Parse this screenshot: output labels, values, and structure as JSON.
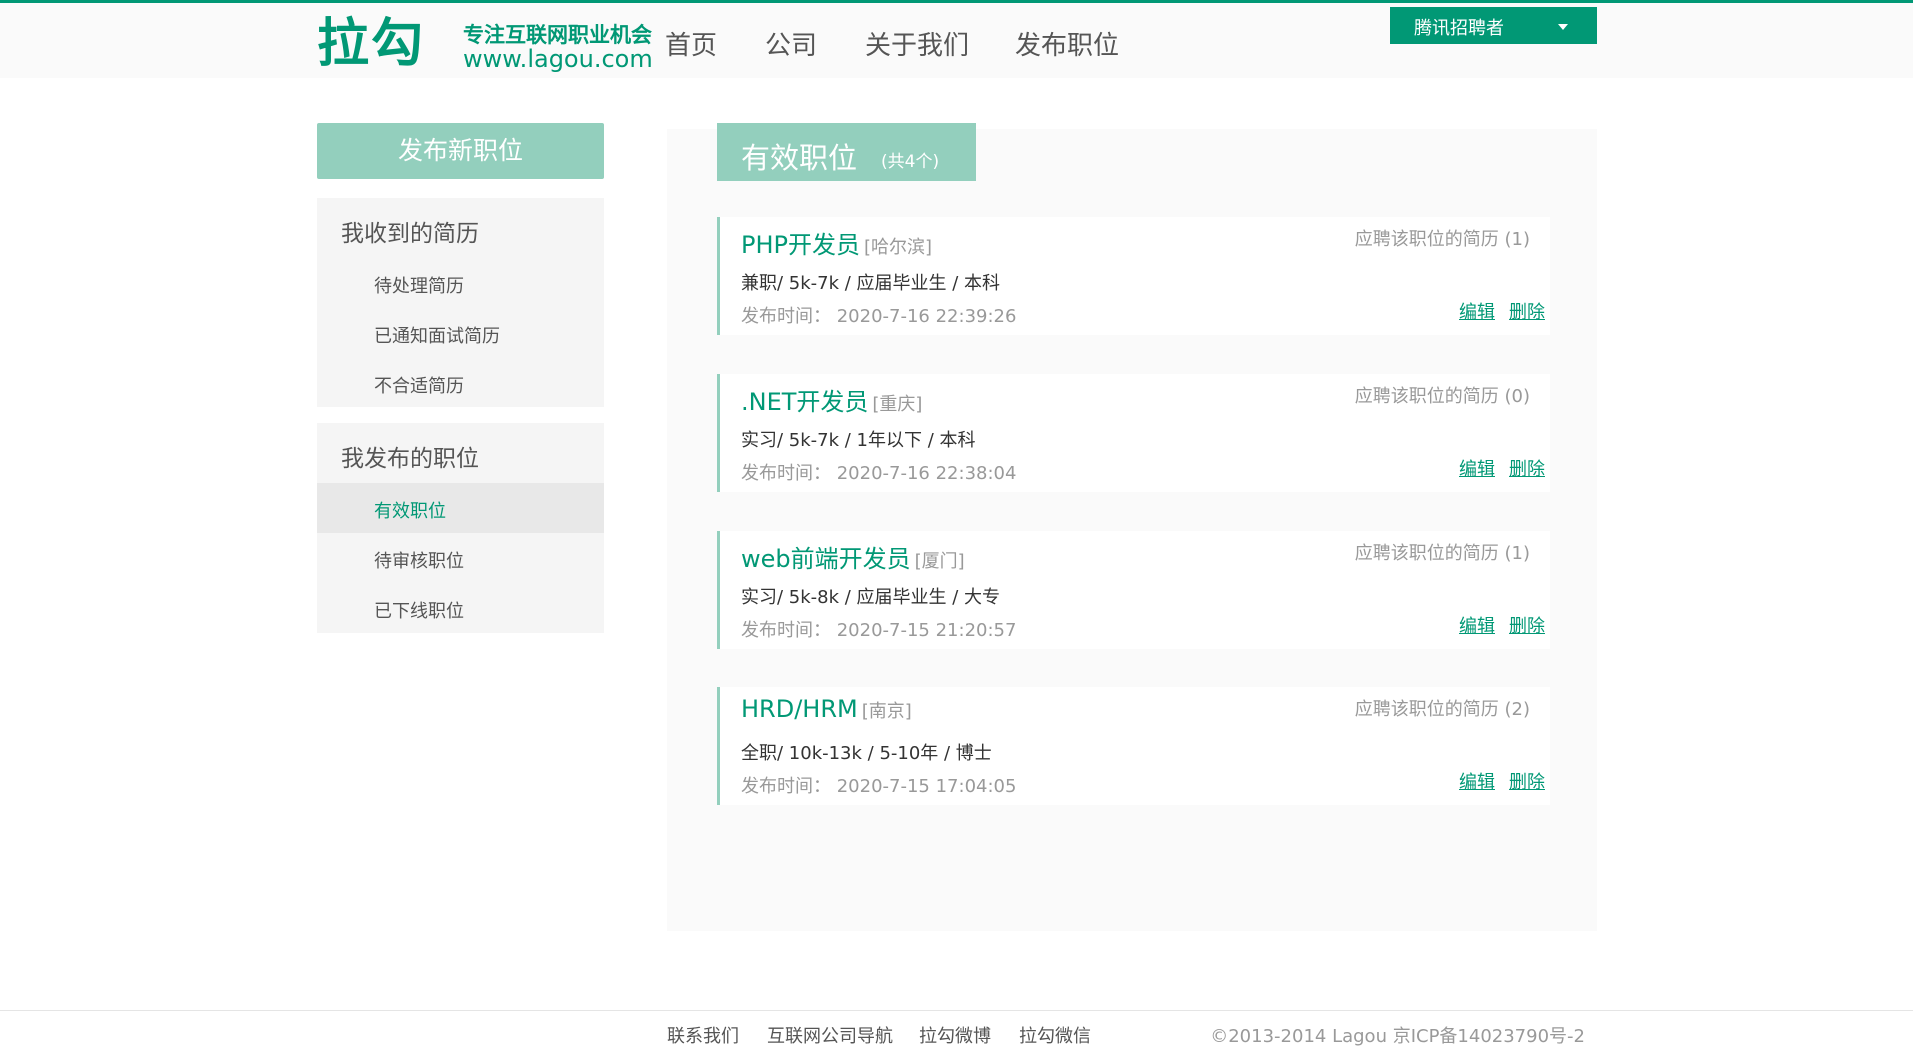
{
  "header": {
    "logo_text": "拉勾",
    "logo_slogan": "专注互联网职业机会",
    "logo_url": "www.lagou.com",
    "nav": [
      "首页",
      "公司",
      "关于我们",
      "发布职位"
    ],
    "user": "腾讯招聘者"
  },
  "sidebar": {
    "post_button": "发布新职位",
    "resume_group_title": "我收到的简历",
    "resume_items": [
      "待处理简历",
      "已通知面试简历",
      "不合适简历"
    ],
    "jobs_group_title": "我发布的职位",
    "job_items": [
      "有效职位",
      "待审核职位",
      "已下线职位"
    ],
    "active_item": "有效职位"
  },
  "main": {
    "tab_title": "有效职位",
    "tab_count": "(共4个)",
    "jobs": [
      {
        "title": "PHP开发员",
        "city": "[哈尔滨]",
        "resumes": "应聘该职位的简历 (1)",
        "info": "兼职/ 5k-7k / 应届毕业生 / 本科",
        "time": "发布时间： 2020-7-16 22:39:26",
        "edit": "编辑",
        "delete": "删除"
      },
      {
        "title": ".NET开发员",
        "city": "[重庆]",
        "resumes": "应聘该职位的简历 (0)",
        "info": "实习/ 5k-7k / 1年以下 / 本科",
        "time": "发布时间： 2020-7-16 22:38:04",
        "edit": "编辑",
        "delete": "删除"
      },
      {
        "title": "web前端开发员",
        "city": "[厦门]",
        "resumes": "应聘该职位的简历 (1)",
        "info": "实习/ 5k-8k / 应届毕业生 / 大专",
        "time": "发布时间： 2020-7-15 21:20:57",
        "edit": "编辑",
        "delete": "删除"
      },
      {
        "title": "HRD/HRM",
        "city": "[南京]",
        "resumes": "应聘该职位的简历 (2)",
        "info": "全职/ 10k-13k / 5-10年 / 博士",
        "time": "发布时间： 2020-7-15 17:04:05",
        "edit": "编辑",
        "delete": "删除"
      }
    ]
  },
  "footer": {
    "links": [
      "联系我们",
      "互联网公司导航",
      "拉勾微博",
      "拉勾微信"
    ],
    "copyright": "©2013-2014 Lagou   京ICP备14023790号-2"
  },
  "colors": {
    "brand": "#019875",
    "brand_light": "#93cfbd"
  }
}
